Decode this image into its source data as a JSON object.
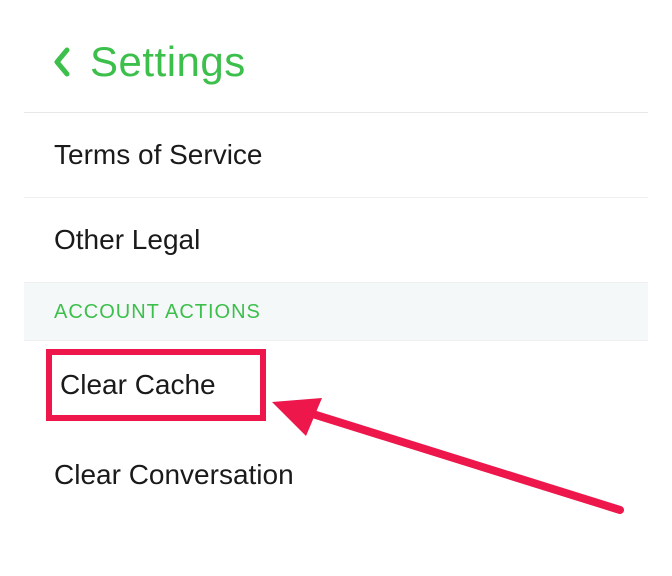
{
  "header": {
    "title": "Settings"
  },
  "items": {
    "terms_of_service": "Terms of Service",
    "other_legal": "Other Legal",
    "clear_cache": "Clear Cache",
    "clear_conversation": "Clear Conversation"
  },
  "section": {
    "account_actions": "ACCOUNT ACTIONS"
  },
  "colors": {
    "accent": "#3dbf4c",
    "highlight": "#ed174b"
  }
}
